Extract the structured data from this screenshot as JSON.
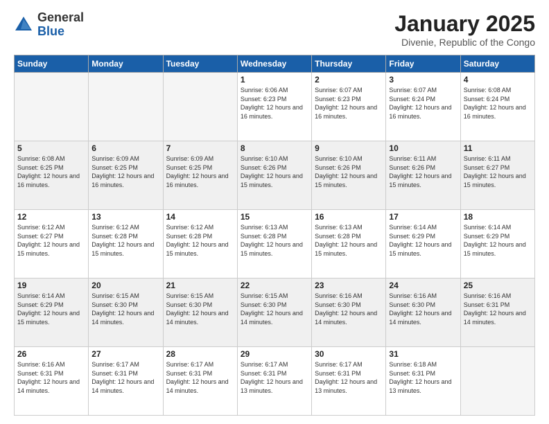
{
  "header": {
    "logo_general": "General",
    "logo_blue": "Blue",
    "month_title": "January 2025",
    "location": "Divenie, Republic of the Congo"
  },
  "weekdays": [
    "Sunday",
    "Monday",
    "Tuesday",
    "Wednesday",
    "Thursday",
    "Friday",
    "Saturday"
  ],
  "weeks": [
    [
      {
        "day": "",
        "info": ""
      },
      {
        "day": "",
        "info": ""
      },
      {
        "day": "",
        "info": ""
      },
      {
        "day": "1",
        "info": "Sunrise: 6:06 AM\nSunset: 6:23 PM\nDaylight: 12 hours and 16 minutes."
      },
      {
        "day": "2",
        "info": "Sunrise: 6:07 AM\nSunset: 6:23 PM\nDaylight: 12 hours and 16 minutes."
      },
      {
        "day": "3",
        "info": "Sunrise: 6:07 AM\nSunset: 6:24 PM\nDaylight: 12 hours and 16 minutes."
      },
      {
        "day": "4",
        "info": "Sunrise: 6:08 AM\nSunset: 6:24 PM\nDaylight: 12 hours and 16 minutes."
      }
    ],
    [
      {
        "day": "5",
        "info": "Sunrise: 6:08 AM\nSunset: 6:25 PM\nDaylight: 12 hours and 16 minutes."
      },
      {
        "day": "6",
        "info": "Sunrise: 6:09 AM\nSunset: 6:25 PM\nDaylight: 12 hours and 16 minutes."
      },
      {
        "day": "7",
        "info": "Sunrise: 6:09 AM\nSunset: 6:25 PM\nDaylight: 12 hours and 16 minutes."
      },
      {
        "day": "8",
        "info": "Sunrise: 6:10 AM\nSunset: 6:26 PM\nDaylight: 12 hours and 15 minutes."
      },
      {
        "day": "9",
        "info": "Sunrise: 6:10 AM\nSunset: 6:26 PM\nDaylight: 12 hours and 15 minutes."
      },
      {
        "day": "10",
        "info": "Sunrise: 6:11 AM\nSunset: 6:26 PM\nDaylight: 12 hours and 15 minutes."
      },
      {
        "day": "11",
        "info": "Sunrise: 6:11 AM\nSunset: 6:27 PM\nDaylight: 12 hours and 15 minutes."
      }
    ],
    [
      {
        "day": "12",
        "info": "Sunrise: 6:12 AM\nSunset: 6:27 PM\nDaylight: 12 hours and 15 minutes."
      },
      {
        "day": "13",
        "info": "Sunrise: 6:12 AM\nSunset: 6:28 PM\nDaylight: 12 hours and 15 minutes."
      },
      {
        "day": "14",
        "info": "Sunrise: 6:12 AM\nSunset: 6:28 PM\nDaylight: 12 hours and 15 minutes."
      },
      {
        "day": "15",
        "info": "Sunrise: 6:13 AM\nSunset: 6:28 PM\nDaylight: 12 hours and 15 minutes."
      },
      {
        "day": "16",
        "info": "Sunrise: 6:13 AM\nSunset: 6:28 PM\nDaylight: 12 hours and 15 minutes."
      },
      {
        "day": "17",
        "info": "Sunrise: 6:14 AM\nSunset: 6:29 PM\nDaylight: 12 hours and 15 minutes."
      },
      {
        "day": "18",
        "info": "Sunrise: 6:14 AM\nSunset: 6:29 PM\nDaylight: 12 hours and 15 minutes."
      }
    ],
    [
      {
        "day": "19",
        "info": "Sunrise: 6:14 AM\nSunset: 6:29 PM\nDaylight: 12 hours and 15 minutes."
      },
      {
        "day": "20",
        "info": "Sunrise: 6:15 AM\nSunset: 6:30 PM\nDaylight: 12 hours and 14 minutes."
      },
      {
        "day": "21",
        "info": "Sunrise: 6:15 AM\nSunset: 6:30 PM\nDaylight: 12 hours and 14 minutes."
      },
      {
        "day": "22",
        "info": "Sunrise: 6:15 AM\nSunset: 6:30 PM\nDaylight: 12 hours and 14 minutes."
      },
      {
        "day": "23",
        "info": "Sunrise: 6:16 AM\nSunset: 6:30 PM\nDaylight: 12 hours and 14 minutes."
      },
      {
        "day": "24",
        "info": "Sunrise: 6:16 AM\nSunset: 6:30 PM\nDaylight: 12 hours and 14 minutes."
      },
      {
        "day": "25",
        "info": "Sunrise: 6:16 AM\nSunset: 6:31 PM\nDaylight: 12 hours and 14 minutes."
      }
    ],
    [
      {
        "day": "26",
        "info": "Sunrise: 6:16 AM\nSunset: 6:31 PM\nDaylight: 12 hours and 14 minutes."
      },
      {
        "day": "27",
        "info": "Sunrise: 6:17 AM\nSunset: 6:31 PM\nDaylight: 12 hours and 14 minutes."
      },
      {
        "day": "28",
        "info": "Sunrise: 6:17 AM\nSunset: 6:31 PM\nDaylight: 12 hours and 14 minutes."
      },
      {
        "day": "29",
        "info": "Sunrise: 6:17 AM\nSunset: 6:31 PM\nDaylight: 12 hours and 13 minutes."
      },
      {
        "day": "30",
        "info": "Sunrise: 6:17 AM\nSunset: 6:31 PM\nDaylight: 12 hours and 13 minutes."
      },
      {
        "day": "31",
        "info": "Sunrise: 6:18 AM\nSunset: 6:31 PM\nDaylight: 12 hours and 13 minutes."
      },
      {
        "day": "",
        "info": ""
      }
    ]
  ]
}
